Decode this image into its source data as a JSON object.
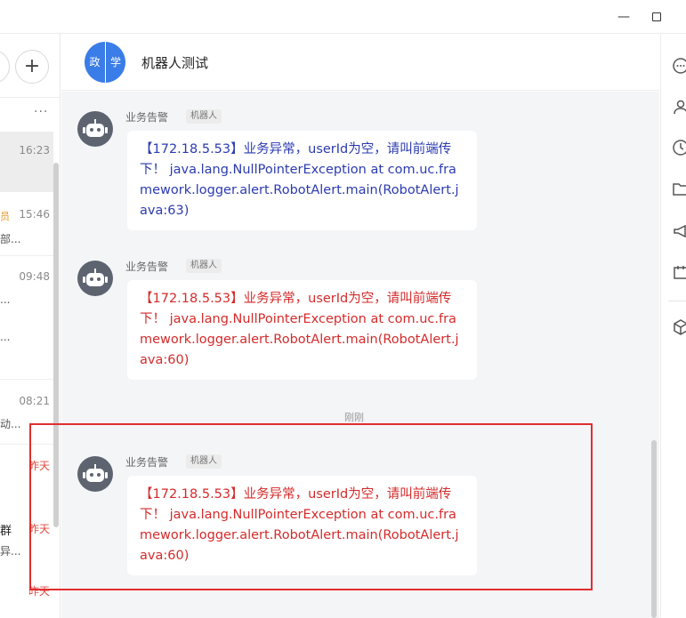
{
  "chat": {
    "title": "机器人测试",
    "avatar_chars": [
      "政",
      "学"
    ],
    "time_divider": "刚刚",
    "messages": [
      {
        "sender": "业务告警",
        "badge": "机器人",
        "text": "【172.18.5.53】业务异常，userId为空，请叫前端传下！ java.lang.NullPointerException at com.uc.framework.logger.alert.RobotAlert.main(RobotAlert.java:63)",
        "color": "#2b3bb0"
      },
      {
        "sender": "业务告警",
        "badge": "机器人",
        "text": "【172.18.5.53】业务异常，userId为空，请叫前端传下！ java.lang.NullPointerException at com.uc.framework.logger.alert.RobotAlert.main(RobotAlert.java:60)",
        "color": "#d42b2b"
      },
      {
        "sender": "业务告警",
        "badge": "机器人",
        "text": "【172.18.5.53】业务异常，userId为空，请叫前端传下！ java.lang.NullPointerException at com.uc.framework.logger.alert.RobotAlert.main(RobotAlert.java:60)",
        "color": "#d42b2b"
      }
    ]
  },
  "sessions": {
    "more": "···",
    "add": "+",
    "items": [
      {
        "time": "16:23"
      },
      {
        "tag": "员",
        "time": "15:46",
        "snippet": "部..."
      },
      {
        "time": "09:48",
        "snippet": "..."
      },
      {
        "snippet": "..."
      },
      {
        "time": "08:21",
        "snippet": "动..."
      },
      {
        "time": "昨天"
      },
      {
        "snippet": "群",
        "time": "昨天",
        "snippet2": "异..."
      },
      {
        "time": "昨天"
      }
    ]
  },
  "window": {
    "minimize": "—"
  },
  "rightbar": {
    "icons": [
      "chat-more-icon",
      "person-icon",
      "clock-icon",
      "folder-icon",
      "megaphone-icon",
      "calendar-icon",
      "cube-icon"
    ]
  },
  "colors": {
    "highlight": "#e22d2d",
    "accent": "#3a7de8"
  }
}
